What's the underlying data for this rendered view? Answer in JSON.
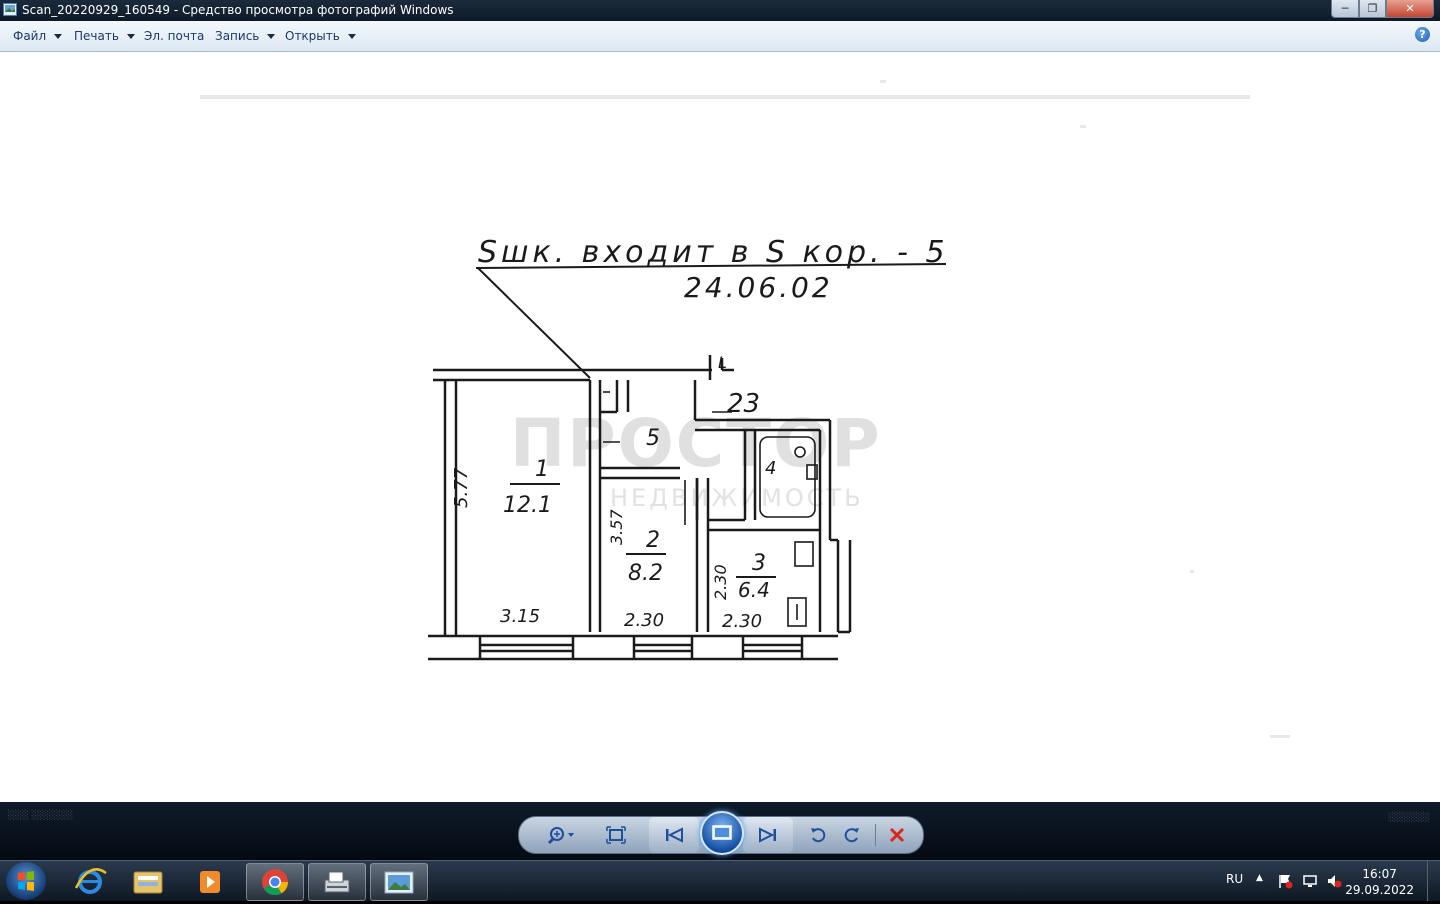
{
  "window": {
    "title": "Scan_20220929_160549 - Средство просмотра фотографий Windows",
    "buttons": [
      "minimize",
      "maximize",
      "close"
    ]
  },
  "menu": {
    "file": "Файл",
    "print": "Печать",
    "email": "Эл. почта",
    "burn": "Запись",
    "open": "Открыть",
    "help_label": "?"
  },
  "floorplan": {
    "header_line1": "Sшк. входит в S кор. - 5",
    "header_line2": "24.06.02",
    "room1_number": "1",
    "room1_area": "12.1",
    "room1_length": "5.77",
    "room1_width": "3.15",
    "room2_number": "2",
    "room2_area": "8.2",
    "room2_length": "3.57",
    "room2_width": "2.30",
    "room3_number": "3",
    "room3_area": "6.4",
    "room3_length": "2.30",
    "room3_width": "2.30",
    "room4_number": "4",
    "room5_number": "5",
    "flat_number": "23",
    "mark_l": "L",
    "watermark_brand": "ПРОСТОР",
    "watermark_sub": "НЕДВИЖИМОСТЬ"
  },
  "controls": {
    "icons": [
      "zoom-icon",
      "actual-size-icon",
      "previous-icon",
      "slideshow-icon",
      "next-icon",
      "rotate-left-icon",
      "rotate-right-icon",
      "delete-icon"
    ]
  },
  "taskbar": {
    "apps": [
      "internet-explorer",
      "file-explorer",
      "media-player",
      "chrome",
      "scanner",
      "photo-viewer"
    ],
    "language": "RU",
    "time": "16:07",
    "date": "29.09.2022"
  },
  "colors": {
    "delete_red": "#d8261c",
    "accent_blue": "#1d5fb6",
    "ink": "#1a1a1a"
  }
}
